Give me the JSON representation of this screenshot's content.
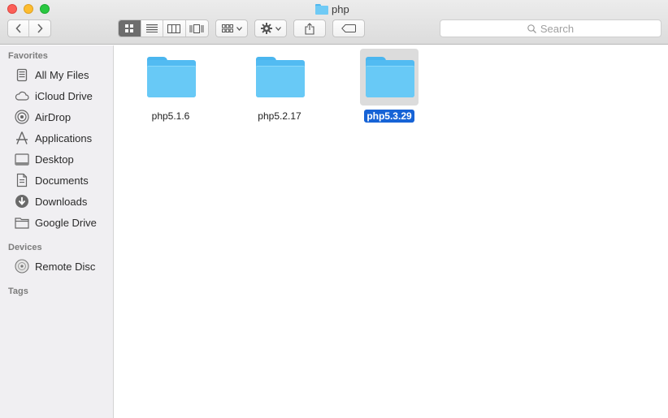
{
  "window": {
    "title": "php"
  },
  "toolbar": {
    "search_placeholder": "Search",
    "view_modes": [
      "icon-view",
      "list-view",
      "column-view",
      "cover-flow-view"
    ],
    "active_view": "icon-view"
  },
  "sidebar": {
    "favorites_title": "Favorites",
    "favorites": [
      {
        "label": "All My Files",
        "icon": "all-files-icon"
      },
      {
        "label": "iCloud Drive",
        "icon": "cloud-icon"
      },
      {
        "label": "AirDrop",
        "icon": "airdrop-icon"
      },
      {
        "label": "Applications",
        "icon": "applications-icon"
      },
      {
        "label": "Desktop",
        "icon": "desktop-icon"
      },
      {
        "label": "Documents",
        "icon": "documents-icon"
      },
      {
        "label": "Downloads",
        "icon": "downloads-icon"
      },
      {
        "label": "Google Drive",
        "icon": "folder-icon"
      }
    ],
    "devices_title": "Devices",
    "devices": [
      {
        "label": "Remote Disc",
        "icon": "disc-icon"
      }
    ],
    "tags_title": "Tags"
  },
  "content": {
    "items": [
      {
        "name": "php5.1.6",
        "selected": false
      },
      {
        "name": "php5.2.17",
        "selected": false
      },
      {
        "name": "php5.3.29",
        "selected": true
      }
    ]
  },
  "colors": {
    "selection": "#1663d6",
    "folder": "#68c9f6",
    "sidebar_bg": "#f0eff2"
  }
}
